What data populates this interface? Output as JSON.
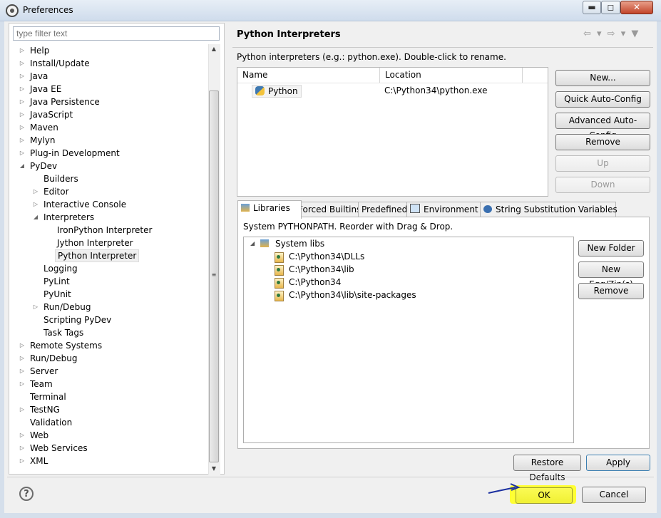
{
  "window": {
    "title": "Preferences",
    "btn_min": "▬",
    "btn_max": "◻",
    "btn_close": "✕"
  },
  "filter": {
    "placeholder": "type filter text"
  },
  "tree": [
    {
      "label": "Help",
      "arrow": "▷"
    },
    {
      "label": "Install/Update",
      "arrow": "▷"
    },
    {
      "label": "Java",
      "arrow": "▷"
    },
    {
      "label": "Java EE",
      "arrow": "▷"
    },
    {
      "label": "Java Persistence",
      "arrow": "▷"
    },
    {
      "label": "JavaScript",
      "arrow": "▷"
    },
    {
      "label": "Maven",
      "arrow": "▷"
    },
    {
      "label": "Mylyn",
      "arrow": "▷"
    },
    {
      "label": "Plug-in Development",
      "arrow": "▷"
    },
    {
      "label": "PyDev",
      "arrow": "◢"
    },
    {
      "label": "Builders",
      "arrow": ""
    },
    {
      "label": "Editor",
      "arrow": "▷"
    },
    {
      "label": "Interactive Console",
      "arrow": "▷"
    },
    {
      "label": "Interpreters",
      "arrow": "◢"
    },
    {
      "label": "IronPython Interpreter",
      "arrow": ""
    },
    {
      "label": "Jython Interpreter",
      "arrow": ""
    },
    {
      "label": "Python Interpreter",
      "arrow": ""
    },
    {
      "label": "Logging",
      "arrow": ""
    },
    {
      "label": "PyLint",
      "arrow": ""
    },
    {
      "label": "PyUnit",
      "arrow": ""
    },
    {
      "label": "Run/Debug",
      "arrow": "▷"
    },
    {
      "label": "Scripting PyDev",
      "arrow": ""
    },
    {
      "label": "Task Tags",
      "arrow": ""
    },
    {
      "label": "Remote Systems",
      "arrow": "▷"
    },
    {
      "label": "Run/Debug",
      "arrow": "▷"
    },
    {
      "label": "Server",
      "arrow": "▷"
    },
    {
      "label": "Team",
      "arrow": "▷"
    },
    {
      "label": "Terminal",
      "arrow": ""
    },
    {
      "label": "TestNG",
      "arrow": "▷"
    },
    {
      "label": "Validation",
      "arrow": ""
    },
    {
      "label": "Web",
      "arrow": "▷"
    },
    {
      "label": "Web Services",
      "arrow": "▷"
    },
    {
      "label": "XML",
      "arrow": "▷"
    }
  ],
  "page": {
    "title": "Python Interpreters",
    "nav": "⇦ ▾ ⇨ ▾ ▼",
    "description": "Python interpreters (e.g.: python.exe).  Double-click to rename.",
    "table": {
      "col_name": "Name",
      "col_location": "Location",
      "rows": [
        {
          "name": "Python",
          "location": "C:\\Python34\\python.exe"
        }
      ]
    },
    "side_buttons": [
      "New...",
      "Quick Auto-Config",
      "Advanced Auto-Config",
      "Remove",
      "Up",
      "Down"
    ],
    "tabs": [
      "Libraries",
      "Forced Builtins",
      "Predefined",
      "Environment",
      "String Substitution Variables"
    ],
    "libraries": {
      "description": "System PYTHONPATH.  Reorder with Drag & Drop.",
      "root": "System libs",
      "root_arrow": "◢",
      "items": [
        "C:\\Python34\\DLLs",
        "C:\\Python34\\lib",
        "C:\\Python34",
        "C:\\Python34\\lib\\site-packages"
      ],
      "buttons": [
        "New Folder",
        "New Egg/Zip(s)",
        "Remove"
      ]
    },
    "restore_defaults": "Restore Defaults",
    "apply": "Apply"
  },
  "footer": {
    "help": "?",
    "ok": "OK",
    "cancel": "Cancel"
  },
  "colors": {
    "highlight": "#ffff33",
    "annotation_arrow": "#1a2fa0"
  }
}
